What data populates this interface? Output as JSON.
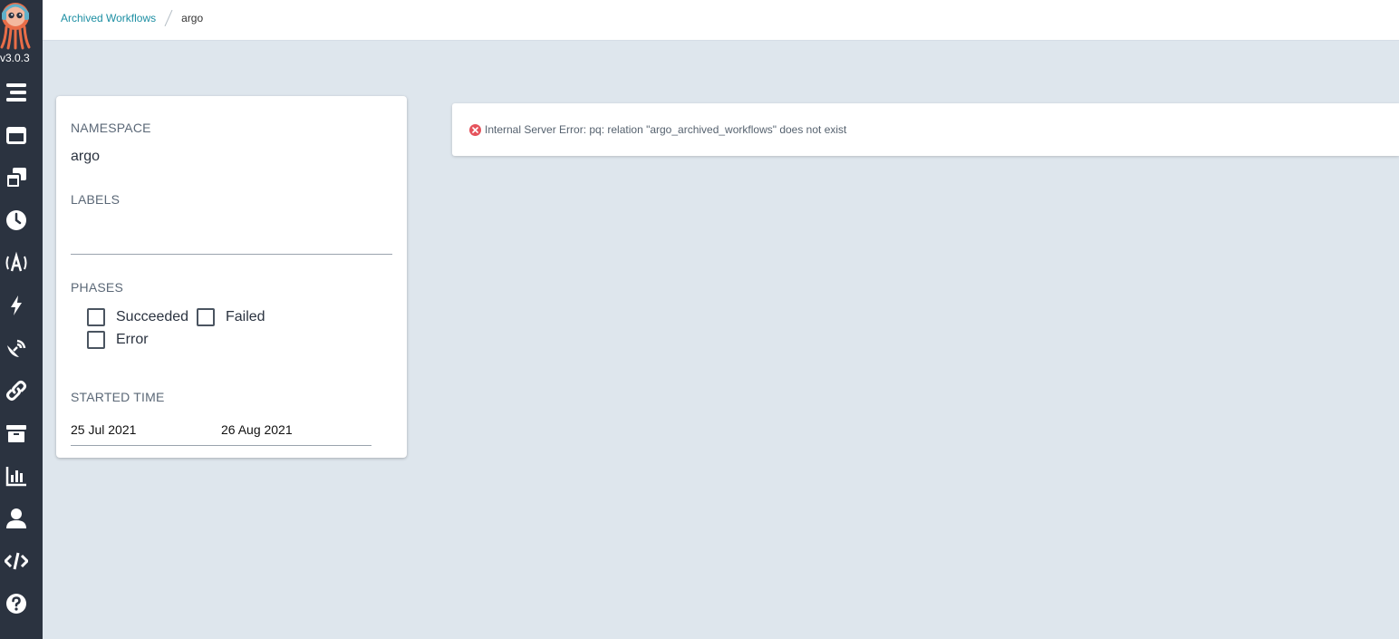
{
  "app": {
    "version": "v3.0.3"
  },
  "sidebar": {
    "items": [
      {
        "icon": "stream-icon"
      },
      {
        "icon": "window-icon"
      },
      {
        "icon": "clone-icon"
      },
      {
        "icon": "clock-icon"
      },
      {
        "icon": "broadcast-icon"
      },
      {
        "icon": "bolt-icon"
      },
      {
        "icon": "satellite-dish-icon"
      },
      {
        "icon": "link-icon"
      },
      {
        "icon": "archive-icon"
      },
      {
        "icon": "chart-bar-icon"
      },
      {
        "icon": "user-icon"
      },
      {
        "icon": "code-icon"
      },
      {
        "icon": "question-circle-icon"
      }
    ]
  },
  "breadcrumb": {
    "parent": "Archived Workflows",
    "current": "argo"
  },
  "filters": {
    "namespace_title": "NAMESPACE",
    "namespace_value": "argo",
    "labels_title": "LABELS",
    "labels_value": "",
    "phases_title": "PHASES",
    "phases": [
      "Succeeded",
      "Failed",
      "Error"
    ],
    "started_time_title": "STARTED TIME",
    "min_date": "25 Jul 2021",
    "max_date": "26 Aug 2021"
  },
  "error": {
    "message": "Internal Server Error: pq: relation \"argo_archived_workflows\" does not exist"
  },
  "colors": {
    "sidebar_bg": "#2b3340",
    "background": "#dee6ed",
    "link": "#1d8fa3",
    "error_icon": "#e5535c"
  }
}
